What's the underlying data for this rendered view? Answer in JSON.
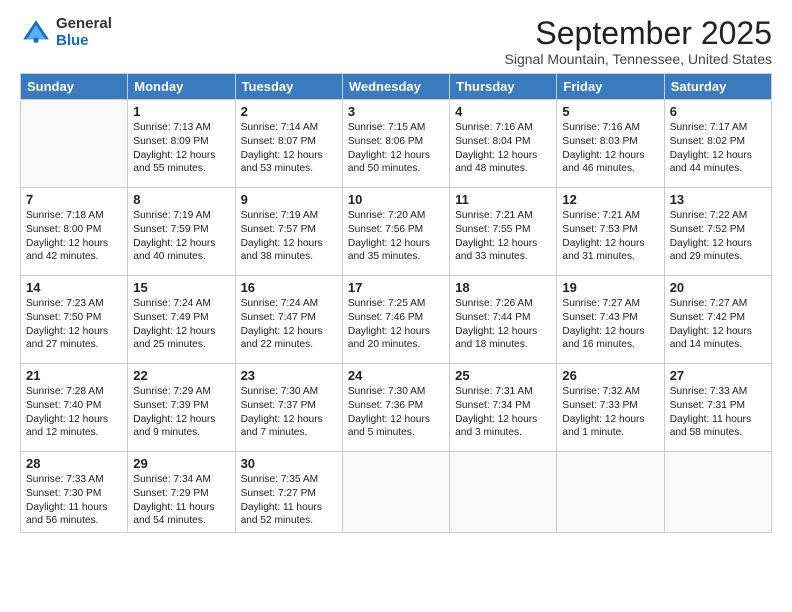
{
  "logo": {
    "general": "General",
    "blue": "Blue",
    "icon_title": "GeneralBlue Logo"
  },
  "header": {
    "month": "September 2025",
    "location": "Signal Mountain, Tennessee, United States"
  },
  "weekdays": [
    "Sunday",
    "Monday",
    "Tuesday",
    "Wednesday",
    "Thursday",
    "Friday",
    "Saturday"
  ],
  "weeks": [
    [
      {
        "day": "",
        "sunrise": "",
        "sunset": "",
        "daylight": ""
      },
      {
        "day": "1",
        "sunrise": "Sunrise: 7:13 AM",
        "sunset": "Sunset: 8:09 PM",
        "daylight": "Daylight: 12 hours and 55 minutes."
      },
      {
        "day": "2",
        "sunrise": "Sunrise: 7:14 AM",
        "sunset": "Sunset: 8:07 PM",
        "daylight": "Daylight: 12 hours and 53 minutes."
      },
      {
        "day": "3",
        "sunrise": "Sunrise: 7:15 AM",
        "sunset": "Sunset: 8:06 PM",
        "daylight": "Daylight: 12 hours and 50 minutes."
      },
      {
        "day": "4",
        "sunrise": "Sunrise: 7:16 AM",
        "sunset": "Sunset: 8:04 PM",
        "daylight": "Daylight: 12 hours and 48 minutes."
      },
      {
        "day": "5",
        "sunrise": "Sunrise: 7:16 AM",
        "sunset": "Sunset: 8:03 PM",
        "daylight": "Daylight: 12 hours and 46 minutes."
      },
      {
        "day": "6",
        "sunrise": "Sunrise: 7:17 AM",
        "sunset": "Sunset: 8:02 PM",
        "daylight": "Daylight: 12 hours and 44 minutes."
      }
    ],
    [
      {
        "day": "7",
        "sunrise": "Sunrise: 7:18 AM",
        "sunset": "Sunset: 8:00 PM",
        "daylight": "Daylight: 12 hours and 42 minutes."
      },
      {
        "day": "8",
        "sunrise": "Sunrise: 7:19 AM",
        "sunset": "Sunset: 7:59 PM",
        "daylight": "Daylight: 12 hours and 40 minutes."
      },
      {
        "day": "9",
        "sunrise": "Sunrise: 7:19 AM",
        "sunset": "Sunset: 7:57 PM",
        "daylight": "Daylight: 12 hours and 38 minutes."
      },
      {
        "day": "10",
        "sunrise": "Sunrise: 7:20 AM",
        "sunset": "Sunset: 7:56 PM",
        "daylight": "Daylight: 12 hours and 35 minutes."
      },
      {
        "day": "11",
        "sunrise": "Sunrise: 7:21 AM",
        "sunset": "Sunset: 7:55 PM",
        "daylight": "Daylight: 12 hours and 33 minutes."
      },
      {
        "day": "12",
        "sunrise": "Sunrise: 7:21 AM",
        "sunset": "Sunset: 7:53 PM",
        "daylight": "Daylight: 12 hours and 31 minutes."
      },
      {
        "day": "13",
        "sunrise": "Sunrise: 7:22 AM",
        "sunset": "Sunset: 7:52 PM",
        "daylight": "Daylight: 12 hours and 29 minutes."
      }
    ],
    [
      {
        "day": "14",
        "sunrise": "Sunrise: 7:23 AM",
        "sunset": "Sunset: 7:50 PM",
        "daylight": "Daylight: 12 hours and 27 minutes."
      },
      {
        "day": "15",
        "sunrise": "Sunrise: 7:24 AM",
        "sunset": "Sunset: 7:49 PM",
        "daylight": "Daylight: 12 hours and 25 minutes."
      },
      {
        "day": "16",
        "sunrise": "Sunrise: 7:24 AM",
        "sunset": "Sunset: 7:47 PM",
        "daylight": "Daylight: 12 hours and 22 minutes."
      },
      {
        "day": "17",
        "sunrise": "Sunrise: 7:25 AM",
        "sunset": "Sunset: 7:46 PM",
        "daylight": "Daylight: 12 hours and 20 minutes."
      },
      {
        "day": "18",
        "sunrise": "Sunrise: 7:26 AM",
        "sunset": "Sunset: 7:44 PM",
        "daylight": "Daylight: 12 hours and 18 minutes."
      },
      {
        "day": "19",
        "sunrise": "Sunrise: 7:27 AM",
        "sunset": "Sunset: 7:43 PM",
        "daylight": "Daylight: 12 hours and 16 minutes."
      },
      {
        "day": "20",
        "sunrise": "Sunrise: 7:27 AM",
        "sunset": "Sunset: 7:42 PM",
        "daylight": "Daylight: 12 hours and 14 minutes."
      }
    ],
    [
      {
        "day": "21",
        "sunrise": "Sunrise: 7:28 AM",
        "sunset": "Sunset: 7:40 PM",
        "daylight": "Daylight: 12 hours and 12 minutes."
      },
      {
        "day": "22",
        "sunrise": "Sunrise: 7:29 AM",
        "sunset": "Sunset: 7:39 PM",
        "daylight": "Daylight: 12 hours and 9 minutes."
      },
      {
        "day": "23",
        "sunrise": "Sunrise: 7:30 AM",
        "sunset": "Sunset: 7:37 PM",
        "daylight": "Daylight: 12 hours and 7 minutes."
      },
      {
        "day": "24",
        "sunrise": "Sunrise: 7:30 AM",
        "sunset": "Sunset: 7:36 PM",
        "daylight": "Daylight: 12 hours and 5 minutes."
      },
      {
        "day": "25",
        "sunrise": "Sunrise: 7:31 AM",
        "sunset": "Sunset: 7:34 PM",
        "daylight": "Daylight: 12 hours and 3 minutes."
      },
      {
        "day": "26",
        "sunrise": "Sunrise: 7:32 AM",
        "sunset": "Sunset: 7:33 PM",
        "daylight": "Daylight: 12 hours and 1 minute."
      },
      {
        "day": "27",
        "sunrise": "Sunrise: 7:33 AM",
        "sunset": "Sunset: 7:31 PM",
        "daylight": "Daylight: 11 hours and 58 minutes."
      }
    ],
    [
      {
        "day": "28",
        "sunrise": "Sunrise: 7:33 AM",
        "sunset": "Sunset: 7:30 PM",
        "daylight": "Daylight: 11 hours and 56 minutes."
      },
      {
        "day": "29",
        "sunrise": "Sunrise: 7:34 AM",
        "sunset": "Sunset: 7:29 PM",
        "daylight": "Daylight: 11 hours and 54 minutes."
      },
      {
        "day": "30",
        "sunrise": "Sunrise: 7:35 AM",
        "sunset": "Sunset: 7:27 PM",
        "daylight": "Daylight: 11 hours and 52 minutes."
      },
      {
        "day": "",
        "sunrise": "",
        "sunset": "",
        "daylight": ""
      },
      {
        "day": "",
        "sunrise": "",
        "sunset": "",
        "daylight": ""
      },
      {
        "day": "",
        "sunrise": "",
        "sunset": "",
        "daylight": ""
      },
      {
        "day": "",
        "sunrise": "",
        "sunset": "",
        "daylight": ""
      }
    ]
  ]
}
